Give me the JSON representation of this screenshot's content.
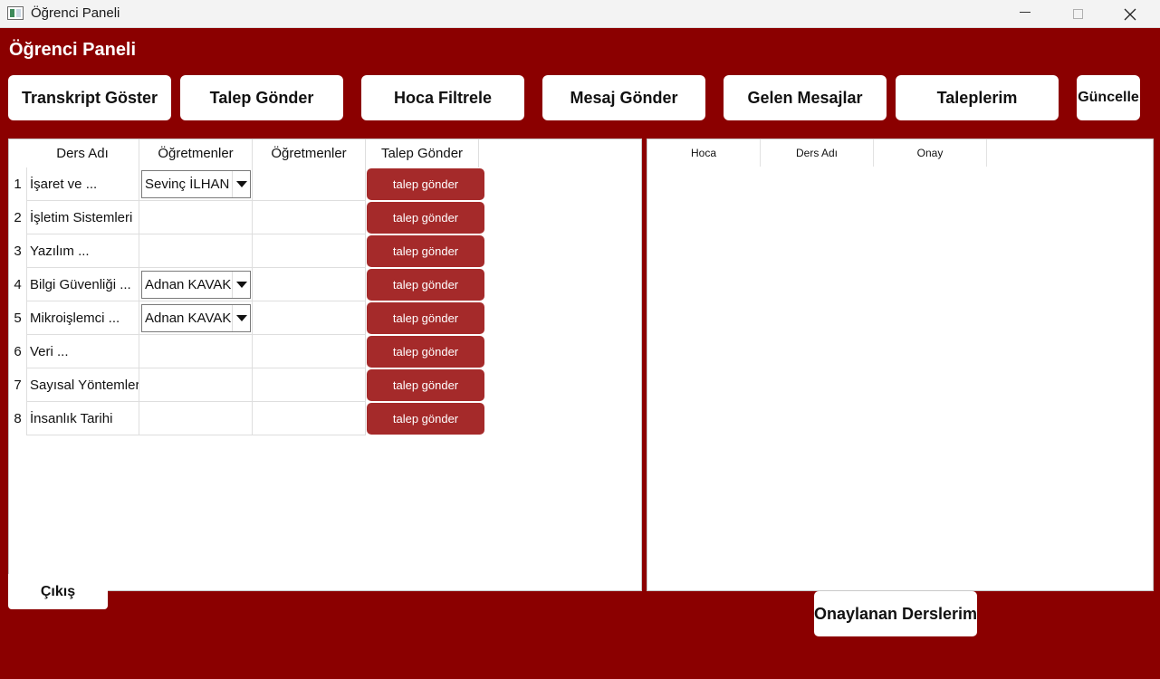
{
  "window": {
    "title": "Öğrenci Paneli",
    "controls": [
      "minimize-icon",
      "maximize-icon",
      "close-icon"
    ]
  },
  "header": {
    "title": "Öğrenci Paneli"
  },
  "toolbar": [
    "Transkript Göster",
    "Talep Gönder",
    "Hoca Filtrele",
    "Mesaj Gönder",
    "Gelen Mesajlar",
    "Taleplerim",
    "Güncelle"
  ],
  "courses_table": {
    "columns": [
      "Ders Adı",
      "Öğretmenler",
      "Öğretmenler",
      "Talep Gönder"
    ],
    "button_label": "talep gönder",
    "rows": [
      {
        "num": "1",
        "course": "İşaret ve ...",
        "teacher": "Sevinç İLHAN O"
      },
      {
        "num": "2",
        "course": "İşletim Sistemleri",
        "teacher": ""
      },
      {
        "num": "3",
        "course": "Yazılım ...",
        "teacher": ""
      },
      {
        "num": "4",
        "course": "Bilgi Güvenliği ...",
        "teacher": "Adnan KAVAK"
      },
      {
        "num": "5",
        "course": "Mikroişlemci ...",
        "teacher": "Adnan KAVAK"
      },
      {
        "num": "6",
        "course": "Veri ...",
        "teacher": ""
      },
      {
        "num": "7",
        "course": "Sayısal Yöntemler",
        "teacher": ""
      },
      {
        "num": "8",
        "course": "İnsanlık Tarihi",
        "teacher": ""
      }
    ]
  },
  "requests_table": {
    "columns": [
      "Hoca",
      "Ders Adı",
      "Onay"
    ]
  },
  "footer": {
    "exit_label": "Çıkış",
    "approved_label": "Onaylanan Derslerim"
  },
  "colors": {
    "background": "#8b0000",
    "request_button": "#a52a2a"
  }
}
